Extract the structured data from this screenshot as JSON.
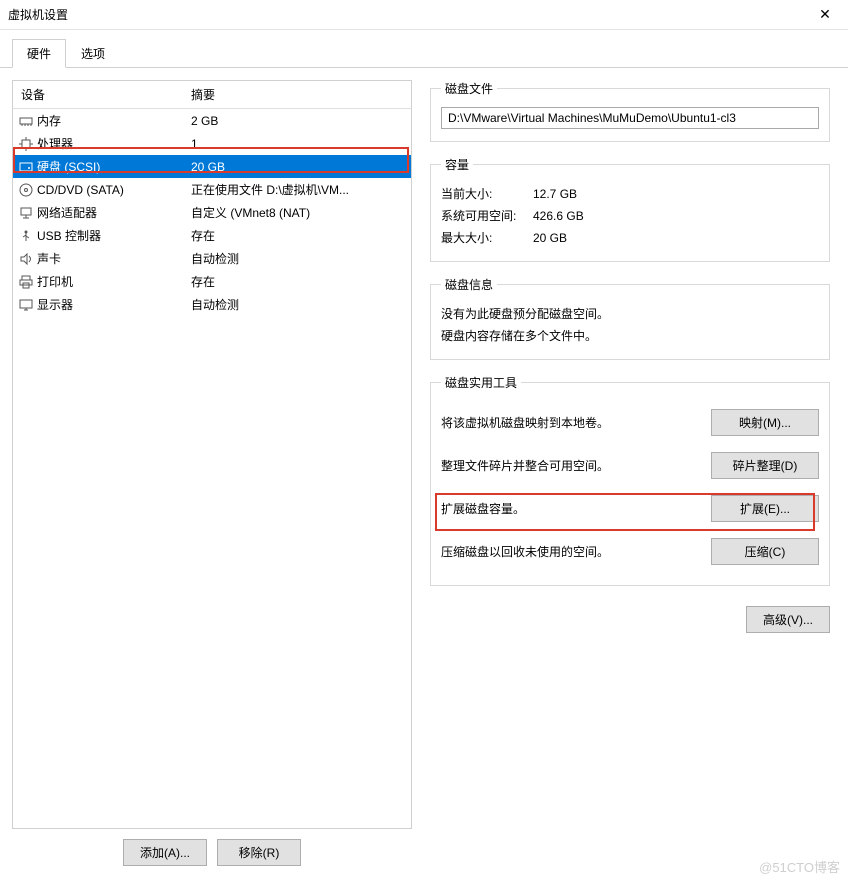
{
  "window": {
    "title": "虚拟机设置",
    "close": "✕"
  },
  "tabs": {
    "hardware": "硬件",
    "options": "选项",
    "active": 0
  },
  "device_table": {
    "headers": {
      "device": "设备",
      "summary": "摘要"
    },
    "rows": [
      {
        "icon": "memory-icon",
        "name": "内存",
        "summary": "2 GB"
      },
      {
        "icon": "cpu-icon",
        "name": "处理器",
        "summary": "1"
      },
      {
        "icon": "disk-icon",
        "name": "硬盘 (SCSI)",
        "summary": "20 GB",
        "selected": true
      },
      {
        "icon": "cd-icon",
        "name": "CD/DVD (SATA)",
        "summary": "正在使用文件 D:\\虚拟机\\VM..."
      },
      {
        "icon": "network-icon",
        "name": "网络适配器",
        "summary": "自定义 (VMnet8 (NAT)"
      },
      {
        "icon": "usb-icon",
        "name": "USB 控制器",
        "summary": "存在"
      },
      {
        "icon": "sound-icon",
        "name": "声卡",
        "summary": "自动检测"
      },
      {
        "icon": "printer-icon",
        "name": "打印机",
        "summary": "存在"
      },
      {
        "icon": "display-icon",
        "name": "显示器",
        "summary": "自动检测"
      }
    ]
  },
  "left_actions": {
    "add": "添加(A)...",
    "remove": "移除(R)"
  },
  "disk_file": {
    "legend": "磁盘文件",
    "path": "D:\\VMware\\Virtual Machines\\MuMuDemo\\Ubuntu1-cl3"
  },
  "capacity": {
    "legend": "容量",
    "current_label": "当前大小:",
    "current_value": "12.7 GB",
    "free_label": "系统可用空间:",
    "free_value": "426.6 GB",
    "max_label": "最大大小:",
    "max_value": "20 GB"
  },
  "disk_info": {
    "legend": "磁盘信息",
    "line1": "没有为此硬盘预分配磁盘空间。",
    "line2": "硬盘内容存储在多个文件中。"
  },
  "utilities": {
    "legend": "磁盘实用工具",
    "map_desc": "将该虚拟机磁盘映射到本地卷。",
    "map_btn": "映射(M)...",
    "defrag_desc": "整理文件碎片并整合可用空间。",
    "defrag_btn": "碎片整理(D)",
    "expand_desc": "扩展磁盘容量。",
    "expand_btn": "扩展(E)...",
    "compact_desc": "压缩磁盘以回收未使用的空间。",
    "compact_btn": "压缩(C)"
  },
  "advanced_btn": "高级(V)...",
  "watermark": "@51CTO博客"
}
